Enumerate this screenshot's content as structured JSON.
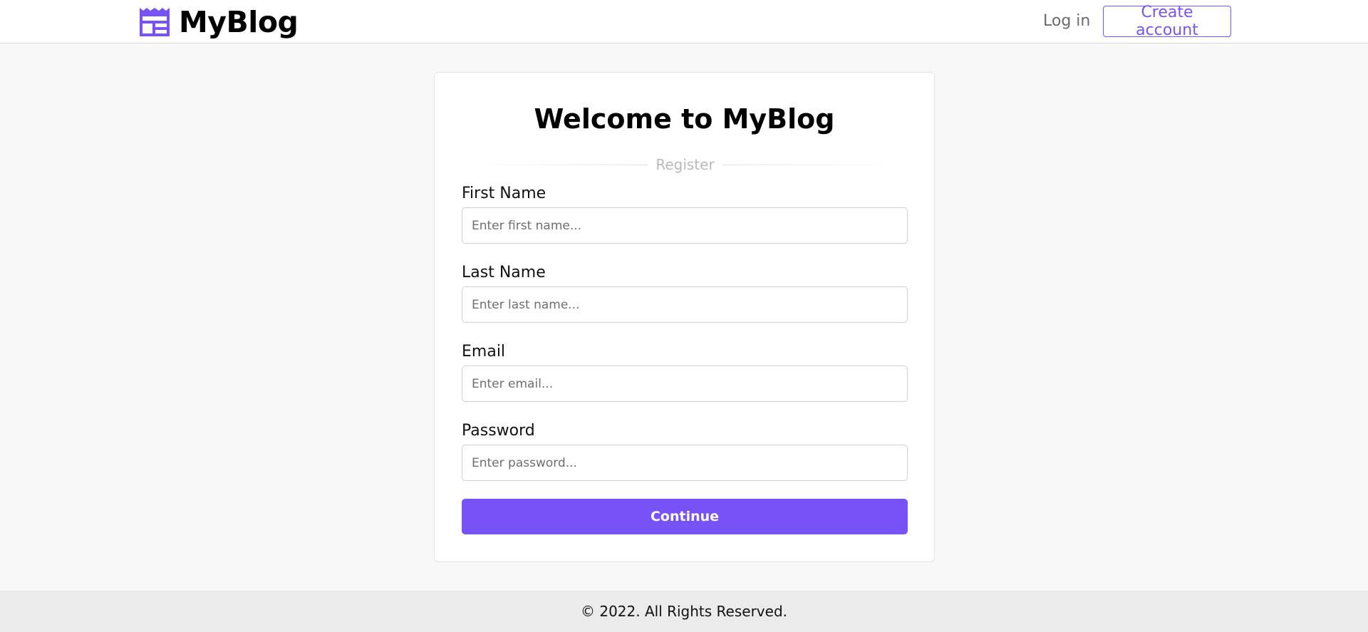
{
  "header": {
    "brand_name": "MyBlog",
    "brand_icon": "blog-layout-icon",
    "login_label": "Log in",
    "create_account_label": "Create account"
  },
  "card": {
    "title": "Welcome to MyBlog",
    "divider_label": "Register",
    "fields": [
      {
        "label": "First Name",
        "placeholder": "Enter first name...",
        "value": ""
      },
      {
        "label": "Last Name",
        "placeholder": "Enter last name...",
        "value": ""
      },
      {
        "label": "Email",
        "placeholder": "Enter email...",
        "value": ""
      },
      {
        "label": "Password",
        "placeholder": "Enter password...",
        "value": ""
      }
    ],
    "continue_label": "Continue"
  },
  "footer": {
    "text": "© 2022. All Rights Reserved."
  },
  "colors": {
    "accent": "#7752f6",
    "page_background": "#f8f8f8",
    "footer_background": "#ebebeb",
    "muted_text": "#6b6b6b"
  }
}
